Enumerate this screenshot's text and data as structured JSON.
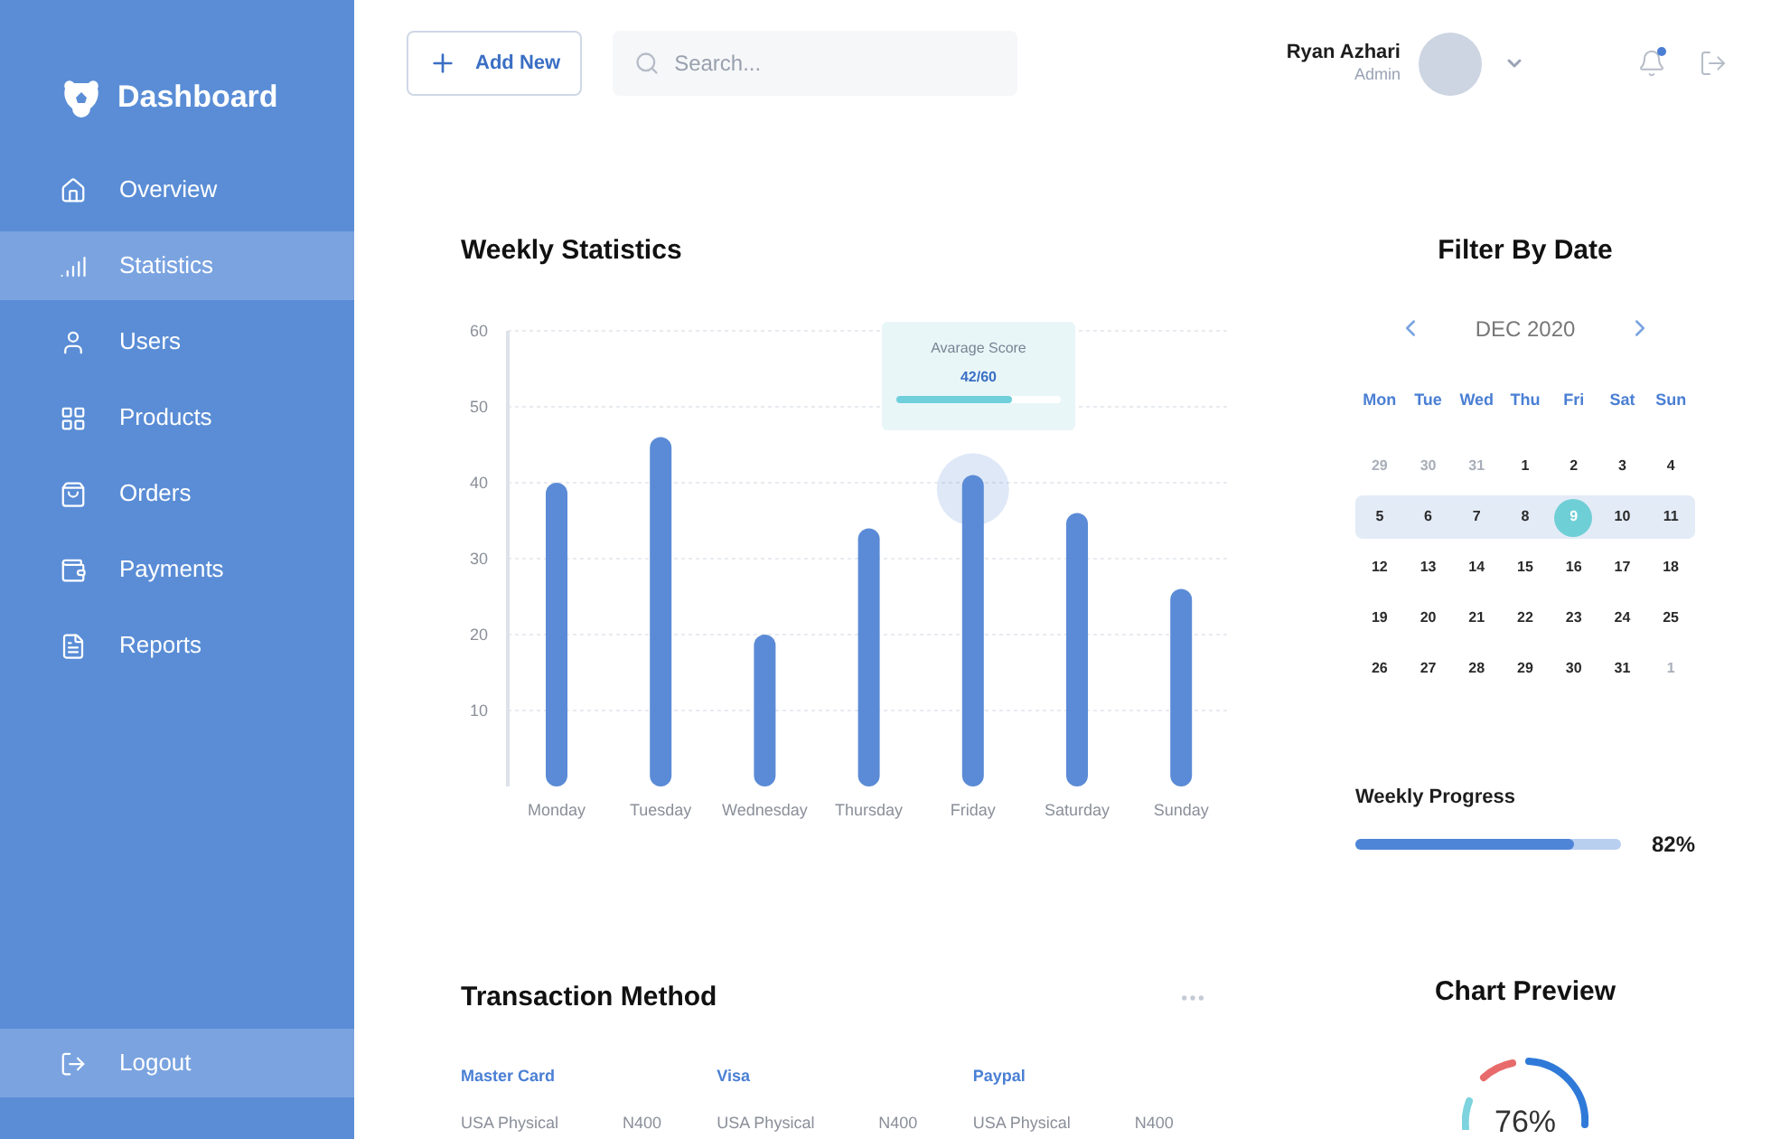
{
  "sidebar": {
    "title": "Dashboard",
    "items": [
      {
        "label": "Overview",
        "selected": false
      },
      {
        "label": "Statistics",
        "selected": true
      },
      {
        "label": "Users",
        "selected": false
      },
      {
        "label": "Products",
        "selected": false
      },
      {
        "label": "Orders",
        "selected": false
      },
      {
        "label": "Payments",
        "selected": false
      },
      {
        "label": "Reports",
        "selected": false
      }
    ],
    "logout": "Logout"
  },
  "header": {
    "add_button": "Add New",
    "search": {
      "placeholder": "Search..."
    },
    "user": {
      "name": "Ryan Azhari",
      "role": "Admin"
    },
    "notification_unread": true
  },
  "weekly_statistics": {
    "title": "Weekly Statistics",
    "chart_data": {
      "type": "bar",
      "categories": [
        "Monday",
        "Tuesday",
        "Wednesday",
        "Thursday",
        "Friday",
        "Saturday",
        "Sunday"
      ],
      "values": [
        40,
        46,
        20,
        34,
        41,
        36,
        26
      ],
      "ylim": [
        0,
        60
      ],
      "yticks": [
        10,
        20,
        30,
        40,
        50,
        60
      ],
      "grid": true
    },
    "tooltip": {
      "title": "Avarage Score",
      "value": "42/60",
      "level": 0.7
    }
  },
  "filter_by_date": {
    "title": "Filter By Date",
    "month": "DEC 2020",
    "weekdays": [
      "Mon",
      "Tue",
      "Wed",
      "Thu",
      "Fri",
      "Sat",
      "Sun"
    ],
    "weeks": [
      {
        "highlighted": false,
        "days": [
          {
            "label": "29",
            "muted": true,
            "selected": false
          },
          {
            "label": "30",
            "muted": true,
            "selected": false
          },
          {
            "label": "31",
            "muted": true,
            "selected": false
          },
          {
            "label": "1",
            "muted": false,
            "selected": false
          },
          {
            "label": "2",
            "muted": false,
            "selected": false
          },
          {
            "label": "3",
            "muted": false,
            "selected": false
          },
          {
            "label": "4",
            "muted": false,
            "selected": false
          }
        ]
      },
      {
        "highlighted": true,
        "days": [
          {
            "label": "5",
            "muted": false,
            "selected": false
          },
          {
            "label": "6",
            "muted": false,
            "selected": false
          },
          {
            "label": "7",
            "muted": false,
            "selected": false
          },
          {
            "label": "8",
            "muted": false,
            "selected": false
          },
          {
            "label": "9",
            "muted": false,
            "selected": true
          },
          {
            "label": "10",
            "muted": false,
            "selected": false
          },
          {
            "label": "11",
            "muted": false,
            "selected": false
          }
        ]
      },
      {
        "highlighted": false,
        "days": [
          {
            "label": "12",
            "muted": false,
            "selected": false
          },
          {
            "label": "13",
            "muted": false,
            "selected": false
          },
          {
            "label": "14",
            "muted": false,
            "selected": false
          },
          {
            "label": "15",
            "muted": false,
            "selected": false
          },
          {
            "label": "16",
            "muted": false,
            "selected": false
          },
          {
            "label": "17",
            "muted": false,
            "selected": false
          },
          {
            "label": "18",
            "muted": false,
            "selected": false
          }
        ]
      },
      {
        "highlighted": false,
        "days": [
          {
            "label": "19",
            "muted": false,
            "selected": false
          },
          {
            "label": "20",
            "muted": false,
            "selected": false
          },
          {
            "label": "21",
            "muted": false,
            "selected": false
          },
          {
            "label": "22",
            "muted": false,
            "selected": false
          },
          {
            "label": "23",
            "muted": false,
            "selected": false
          },
          {
            "label": "24",
            "muted": false,
            "selected": false
          },
          {
            "label": "25",
            "muted": false,
            "selected": false
          }
        ]
      },
      {
        "highlighted": false,
        "days": [
          {
            "label": "26",
            "muted": false,
            "selected": false
          },
          {
            "label": "27",
            "muted": false,
            "selected": false
          },
          {
            "label": "28",
            "muted": false,
            "selected": false
          },
          {
            "label": "29",
            "muted": false,
            "selected": false
          },
          {
            "label": "30",
            "muted": false,
            "selected": false
          },
          {
            "label": "31",
            "muted": false,
            "selected": false
          },
          {
            "label": "1",
            "muted": true,
            "selected": false
          }
        ]
      }
    ]
  },
  "weekly_progress": {
    "title": "Weekly Progress",
    "level": 0.82,
    "reading": "82%"
  },
  "transaction_method": {
    "title": "Transaction Method",
    "methods": [
      {
        "name": "Master Card",
        "type": "USA Physical",
        "amount": "N400"
      },
      {
        "name": "Visa",
        "type": "USA Physical",
        "amount": "N400"
      },
      {
        "name": "Paypal",
        "type": "USA Physical",
        "amount": "N400"
      }
    ]
  },
  "chart_preview": {
    "title": "Chart Preview",
    "reading": "76%"
  }
}
